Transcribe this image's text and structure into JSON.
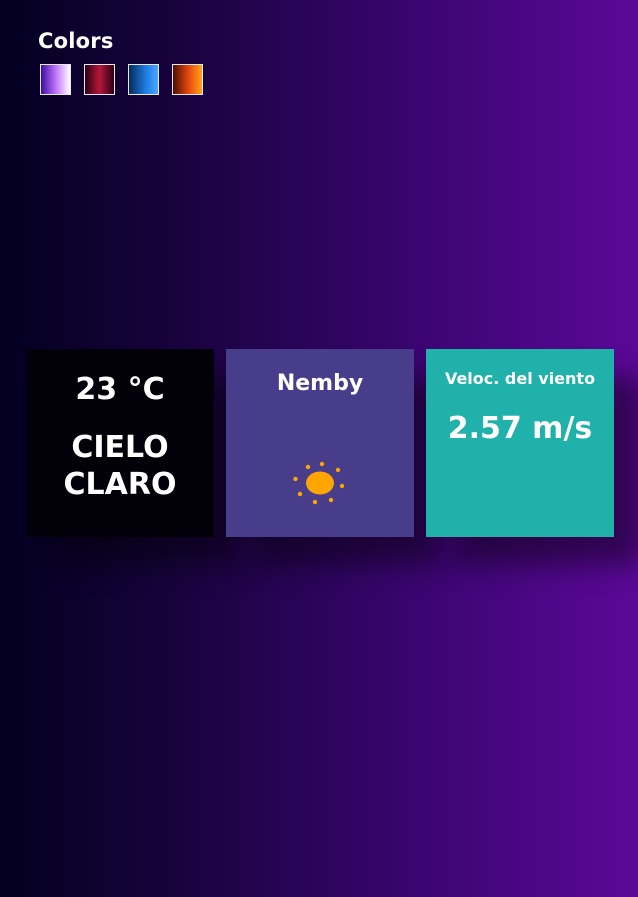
{
  "colors": {
    "title": "Colors",
    "swatches": [
      {
        "name": "purple-white"
      },
      {
        "name": "crimson"
      },
      {
        "name": "blue"
      },
      {
        "name": "orange"
      }
    ]
  },
  "weather": {
    "temperature": "23 °C",
    "description": "CIELO CLARO",
    "city": "Nemby",
    "icon": "sun-icon",
    "wind_label": "Veloc. del viento",
    "wind_value": "2.57 m/s"
  },
  "palette": {
    "card_temp_bg": "#020008",
    "card_city_bg": "#483d8b",
    "card_wind_bg": "#20b2aa",
    "sun_color": "#ffa500"
  }
}
